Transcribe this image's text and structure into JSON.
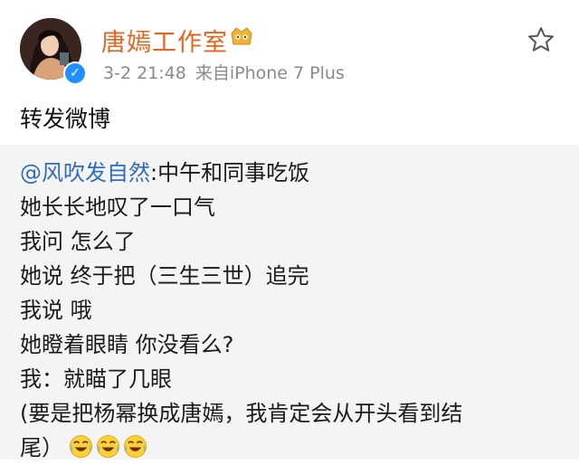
{
  "post": {
    "author_name": "唐嫣工作室",
    "timestamp": "3-2 21:48",
    "source": "来自iPhone 7 Plus",
    "text": "转发微博",
    "icons": {
      "verified": "verified-badge-icon",
      "vip": "vip-member-icon",
      "favorite": "star-icon"
    }
  },
  "quote": {
    "mention": "@风吹发自然",
    "first_line_rest": ":中午和同事吃饭",
    "lines": [
      "她长长地叹了一口气",
      "我问 怎么了",
      "她说 终于把（三生三世）追完",
      "我说 哦",
      "她瞪着眼睛 你没看么?",
      "我：就瞄了几眼",
      "(要是把杨幂换成唐嫣，我肯定会从开头看到结"
    ],
    "last_line": "尾）",
    "trailing_emoji": [
      "laugh-cry-icon",
      "laugh-cry-icon",
      "laugh-cry-icon"
    ]
  },
  "colors": {
    "author": "#e7641f",
    "mention": "#2f6bbf",
    "verified": "#1e90ff",
    "quote_bg": "#f4f4f4",
    "meta": "#8a8a8a"
  }
}
